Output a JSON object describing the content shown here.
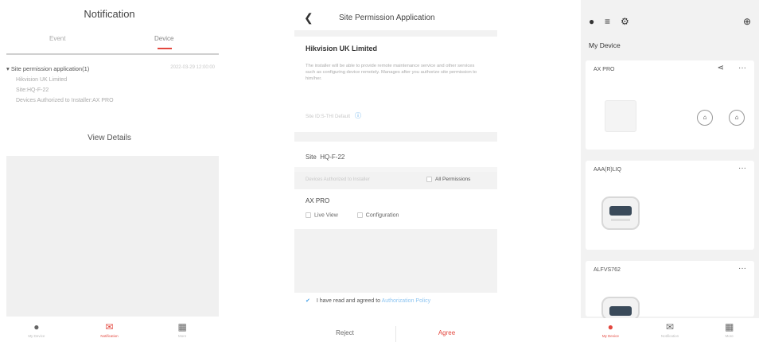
{
  "left_screen": {
    "title": "Notification",
    "tabs": [
      "Event",
      "Device"
    ],
    "message": {
      "title": "Site permission application(1)",
      "time": "2022-03-29 12:00:00",
      "lines": [
        "Hikvision UK Limited",
        "Site:HQ-F-22",
        "Devices Authorized to Installer:AX PRO"
      ]
    },
    "view_details": "View Details",
    "nav": [
      {
        "icon": "device-icon",
        "label": "My Device"
      },
      {
        "icon": "notification-icon",
        "label": "Notification"
      },
      {
        "icon": "more-icon",
        "label": "More"
      }
    ]
  },
  "middle_screen": {
    "title": "Site Permission Application",
    "company": "Hikvision UK Limited",
    "description": "The installer will be able to provide remote maintenance service and other services such as configuring device remotely. Manages after you authorize site permission to him/her.",
    "validity": "Site ID:S-THI Default",
    "site_label": "Site",
    "site_value": "HQ-F-22",
    "devices_authorized_label": "Devices Authorized to Installer",
    "all_permissions": "All Permissions",
    "device_name": "AX PRO",
    "options": [
      "Live View",
      "Configuration"
    ],
    "agree_text": "I have read and agreed to",
    "agree_link": "Authorization Policy",
    "reject": "Reject",
    "agree": "Agree"
  },
  "right_screen": {
    "title": "My Device",
    "devices": [
      {
        "name": "AX PRO",
        "image": "hub"
      },
      {
        "name": "AAA(R)LIQ",
        "image": "keypad"
      },
      {
        "name": "ALFVS762",
        "image": "keypad"
      }
    ],
    "nav": [
      {
        "icon": "device-icon",
        "label": "My Device"
      },
      {
        "icon": "notification-icon",
        "label": "Notification"
      },
      {
        "icon": "more-icon",
        "label": "More"
      }
    ]
  },
  "colors": {
    "accent": "#e3473e",
    "link": "#4aa3e8"
  }
}
